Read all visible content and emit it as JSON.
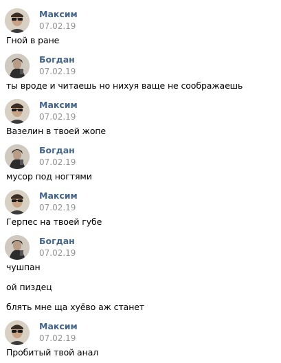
{
  "messages": [
    {
      "author": "Максим",
      "date": "07.02.19",
      "lines": [
        "Гной в ране"
      ]
    },
    {
      "author": "Богдан",
      "date": "07.02.19",
      "lines": [
        "ты вроде и читаешь но нихуя ваще не соображаешь"
      ]
    },
    {
      "author": "Максим",
      "date": "07.02.19",
      "lines": [
        "Вазелин в твоей жопе"
      ]
    },
    {
      "author": "Богдан",
      "date": "07.02.19",
      "lines": [
        "мусор под ногтями"
      ]
    },
    {
      "author": "Максим",
      "date": "07.02.19",
      "lines": [
        "Герпес на твоей губе"
      ]
    },
    {
      "author": "Богдан",
      "date": "07.02.19",
      "lines": [
        "чушпан",
        "ой пиздец",
        "блять мне ща хуёво аж станет"
      ]
    },
    {
      "author": "Максим",
      "date": "07.02.19",
      "lines": [
        "Пробитый твой анал"
      ]
    }
  ],
  "colors": {
    "author": "#42648b",
    "date": "#939393",
    "text": "#000000"
  },
  "icons": {
    "maksim_avatar": "avatar-sunglasses-icon",
    "bogdan_avatar": "avatar-hooded-icon"
  }
}
